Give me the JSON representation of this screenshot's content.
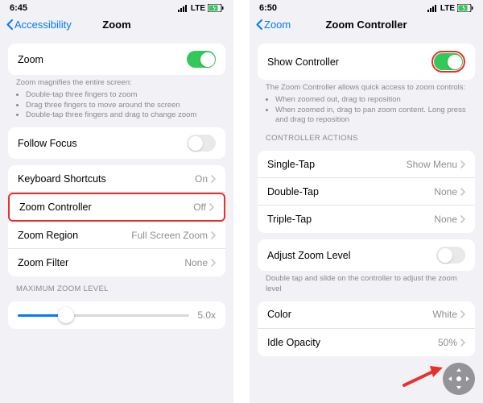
{
  "left": {
    "status_time": "6:45",
    "status_net": "LTE",
    "back_label": "Accessibility",
    "title": "Zoom",
    "zoom_label": "Zoom",
    "zoom_on": true,
    "hint_heading": "Zoom magnifies the entire screen:",
    "hint_items": [
      "Double-tap three fingers to zoom",
      "Drag three fingers to move around the screen",
      "Double-tap three fingers and drag to change zoom"
    ],
    "follow_focus_label": "Follow Focus",
    "follow_focus_on": false,
    "keyboard_shortcuts_label": "Keyboard Shortcuts",
    "keyboard_shortcuts_value": "On",
    "zoom_controller_label": "Zoom Controller",
    "zoom_controller_value": "Off",
    "zoom_region_label": "Zoom Region",
    "zoom_region_value": "Full Screen Zoom",
    "zoom_filter_label": "Zoom Filter",
    "zoom_filter_value": "None",
    "max_header": "MAXIMUM ZOOM LEVEL",
    "slider_value_label": "5.0x",
    "slider_percent": 28
  },
  "right": {
    "status_time": "6:50",
    "status_net": "LTE",
    "back_label": "Zoom",
    "title": "Zoom Controller",
    "show_controller_label": "Show Controller",
    "show_controller_on": true,
    "hint_heading": "The Zoom Controller allows quick access to zoom controls:",
    "hint_items": [
      "When zoomed out, drag to reposition",
      "When zoomed in, drag to pan zoom content. Long press and drag to reposition"
    ],
    "actions_header": "CONTROLLER ACTIONS",
    "single_tap_label": "Single-Tap",
    "single_tap_value": "Show Menu",
    "double_tap_label": "Double-Tap",
    "double_tap_value": "None",
    "triple_tap_label": "Triple-Tap",
    "triple_tap_value": "None",
    "adjust_zoom_label": "Adjust Zoom Level",
    "adjust_zoom_on": false,
    "adjust_hint": "Double tap and slide on the controller to adjust the zoom level",
    "color_label": "Color",
    "color_value": "White",
    "opacity_label": "Idle Opacity",
    "opacity_value": "50%"
  }
}
